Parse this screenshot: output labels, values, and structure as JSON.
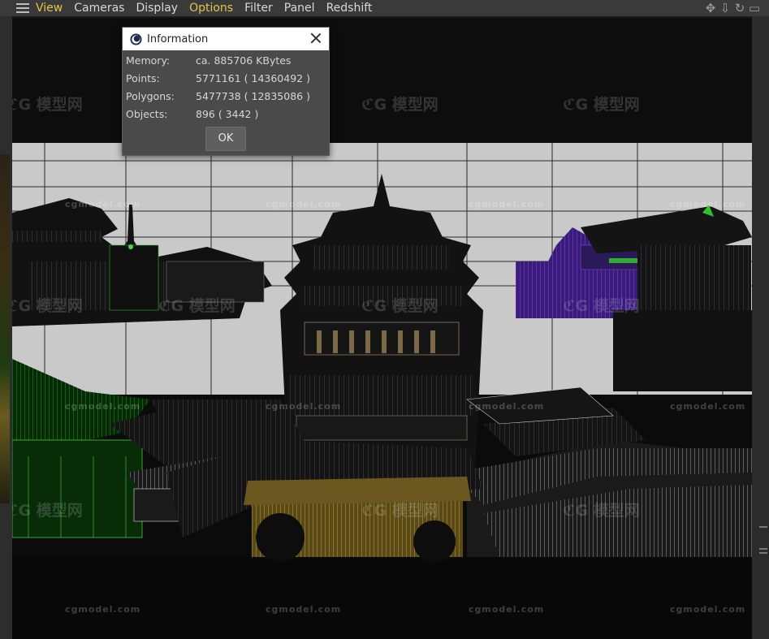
{
  "menubar": {
    "items": [
      {
        "label": "View",
        "active": true
      },
      {
        "label": "Cameras",
        "active": false
      },
      {
        "label": "Display",
        "active": false
      },
      {
        "label": "Options",
        "active": true
      },
      {
        "label": "Filter",
        "active": false
      },
      {
        "label": "Panel",
        "active": false
      },
      {
        "label": "Redshift",
        "active": false
      }
    ],
    "nav_icons": [
      "move-view-icon",
      "dolly-view-icon",
      "rotate-view-icon",
      "switch-view-icon"
    ]
  },
  "dialog": {
    "title": "Information",
    "rows": [
      {
        "label": "Memory:",
        "value": "ca. 885706 KBytes"
      },
      {
        "label": "Points:",
        "value": "5771161 ( 14360492 )"
      },
      {
        "label": "Polygons:",
        "value": "5477738 ( 12835086 )"
      },
      {
        "label": "Objects:",
        "value": "896 ( 3442 )"
      }
    ],
    "ok_label": "OK"
  },
  "colors": {
    "menu_active": "#e6c34a",
    "menu_text": "#d8d8d8",
    "dialog_bg": "#4a4a4a",
    "sky": "#c9c9c9"
  }
}
